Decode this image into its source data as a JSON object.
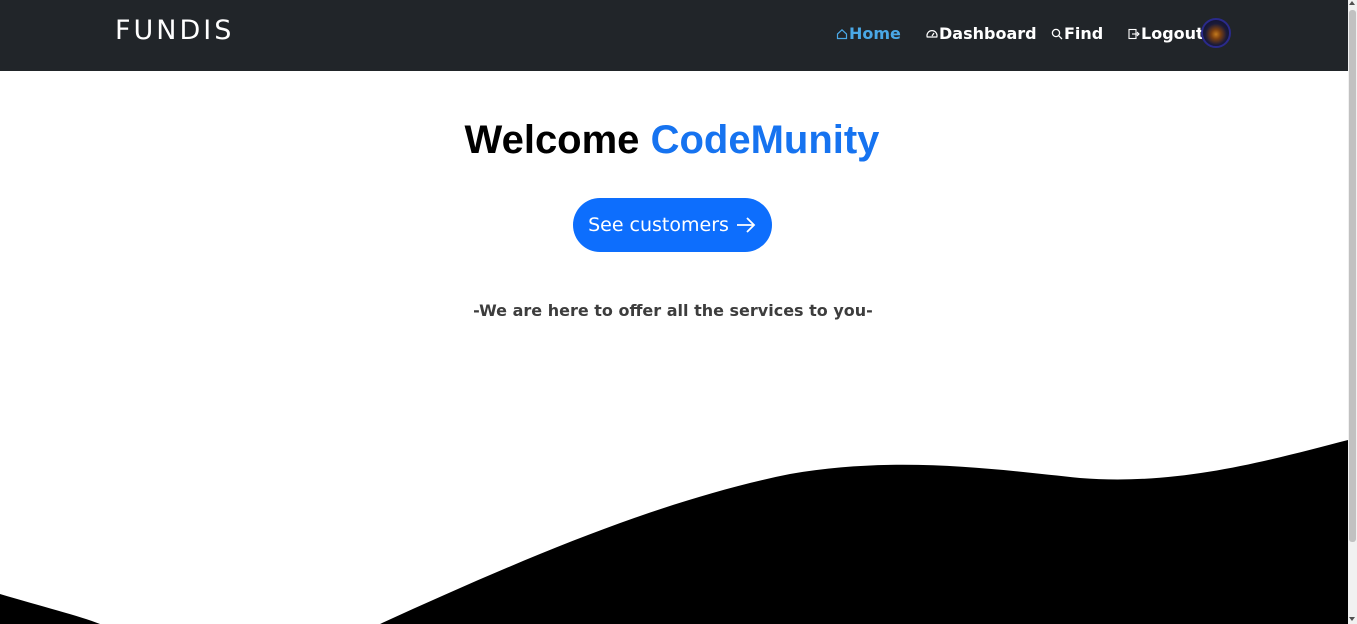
{
  "brand": "FUNDIS",
  "nav": {
    "items": [
      {
        "label": "Home",
        "icon": "home-icon",
        "active": true
      },
      {
        "label": "Dashboard",
        "icon": "speedometer-icon",
        "active": false
      },
      {
        "label": "Find",
        "icon": "search-icon",
        "active": false
      },
      {
        "label": "Logout",
        "icon": "logout-icon",
        "active": false
      }
    ]
  },
  "hero": {
    "title_prefix": "Welcome",
    "title_highlight": "CodeMunity",
    "cta_label": "See customers",
    "tagline": "-We are here to offer all the services to you-"
  },
  "colors": {
    "navbar": "#212529",
    "accent": "#1673f0",
    "button": "#0d6efd",
    "active_nav": "#4aa8e6",
    "wave": "#000000"
  }
}
